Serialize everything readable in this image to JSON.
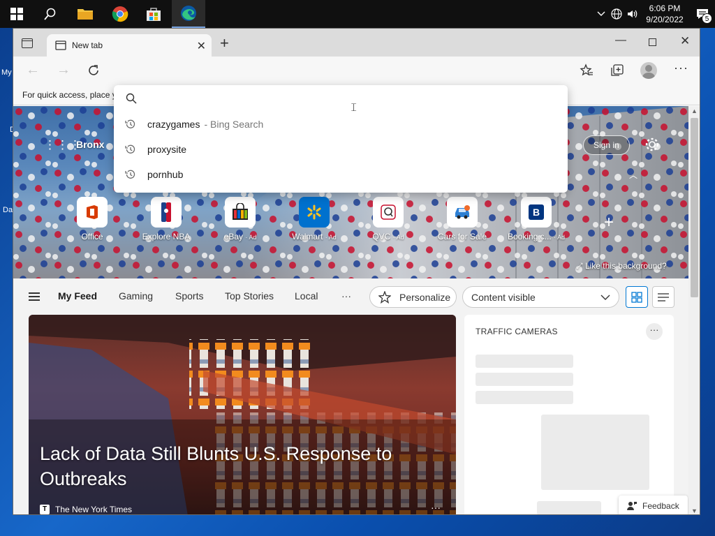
{
  "taskbar": {
    "time": "6:06 PM",
    "date": "9/20/2022",
    "notification_count": "5"
  },
  "desktop": {
    "labels": [
      "My",
      "D",
      "Da"
    ]
  },
  "browser": {
    "tab_title": "New tab",
    "favorites_hint": "For quick access, place y"
  },
  "address_dropdown": {
    "suggestions": [
      {
        "text": "crazygames",
        "sub": "- Bing Search"
      },
      {
        "text": "proxysite",
        "sub": ""
      },
      {
        "text": "pornhub",
        "sub": ""
      }
    ]
  },
  "newtab": {
    "location": "Bronx",
    "sign_in": "Sign in",
    "like_background": "Like this background?",
    "quick_links": [
      {
        "label": "Office",
        "ad": ""
      },
      {
        "label": "Explore NBA",
        "ad": ""
      },
      {
        "label": "eBay",
        "ad": "· Ad"
      },
      {
        "label": "Walmart",
        "ad": "· Ad"
      },
      {
        "label": "QVC",
        "ad": "· Ad"
      },
      {
        "label": "Cars for Sale",
        "ad": ""
      },
      {
        "label": "Booking.c...",
        "ad": "· Ad"
      }
    ],
    "feed_nav": [
      "My Feed",
      "Gaming",
      "Sports",
      "Top Stories",
      "Local"
    ],
    "more": "···",
    "personalize": "Personalize",
    "content_visible": "Content visible",
    "headline": "Lack of Data Still Blunts U.S. Response to Outbreaks",
    "source": "The New York Times",
    "traffic_title": "TRAFFIC CAMERAS",
    "feedback": "Feedback"
  },
  "colors": {
    "accent": "#0078d4",
    "taskbar": "#101010"
  }
}
